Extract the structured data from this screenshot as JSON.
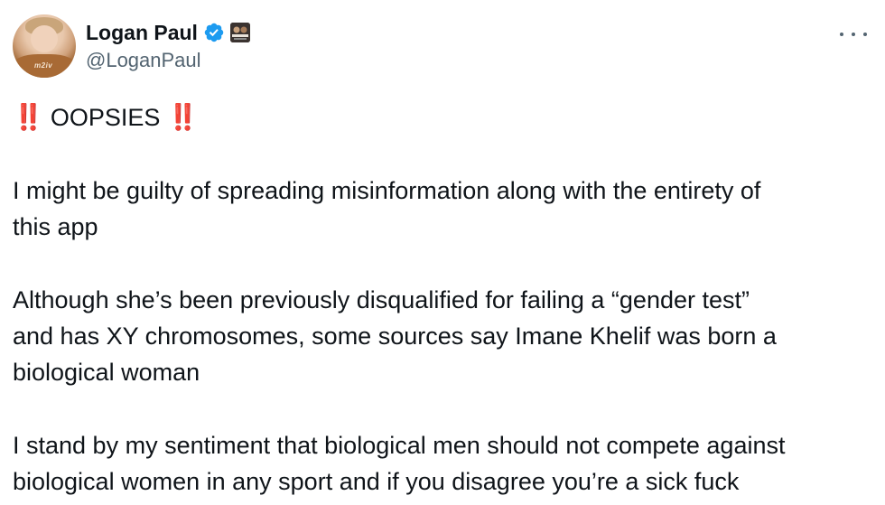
{
  "user": {
    "display_name": "Logan Paul",
    "handle": "@LoganPaul",
    "avatar_shirt_text": "m2iv",
    "verified_color": "#1d9bf0"
  },
  "tweet": {
    "emoji": "‼️",
    "headline": "OOPSIES",
    "paragraph1_line1": "I might be guilty of spreading misinformation along with the entirety of",
    "paragraph1_line2": "this app",
    "paragraph2_line1": "Although she’s been previously disqualified for failing a “gender test”",
    "paragraph2_line2": "and has XY chromosomes, some sources say Imane Khelif was born a",
    "paragraph2_line3": "biological woman",
    "paragraph3_line1": "I stand by my sentiment that biological men should not compete against",
    "paragraph3_line2": "biological women in any sport and if you disagree you’re a sick fuck"
  },
  "icons": {
    "verified": "verified-badge-icon",
    "more": "more-options-icon",
    "affiliate": "affiliate-badge-icon"
  }
}
